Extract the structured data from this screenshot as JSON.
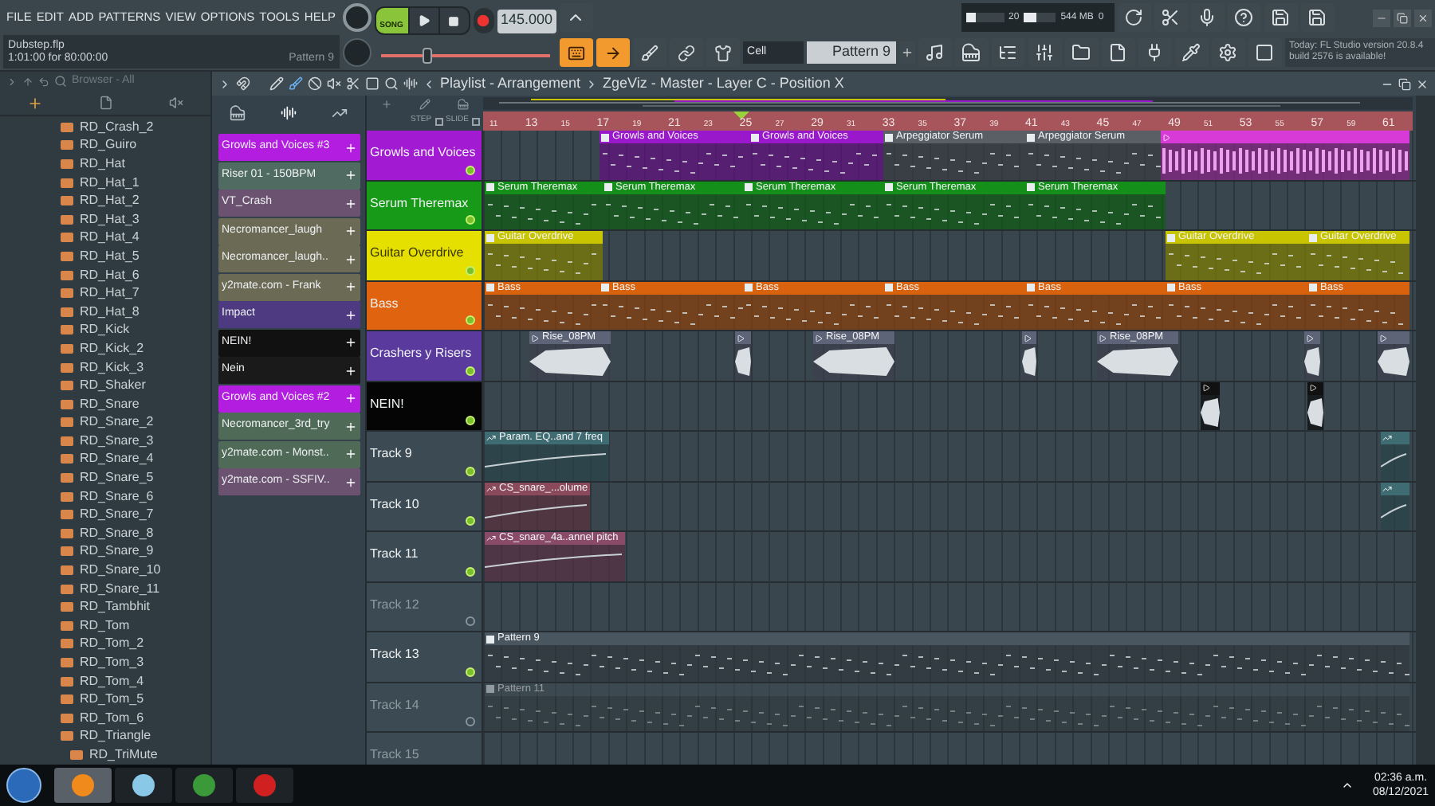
{
  "menu": [
    "FILE",
    "EDIT",
    "ADD",
    "PATTERNS",
    "VIEW",
    "OPTIONS",
    "TOOLS",
    "HELP"
  ],
  "hint_panel": {
    "file": "Dubstep.flp",
    "time": "1:01:00 for 80:00:00",
    "pattern": "Pattern 9"
  },
  "transport": {
    "mode": "SONG",
    "song_mode": true,
    "tempo": "145.000",
    "pitch": {
      "level": 0.28
    }
  },
  "toolbar_toggles": [
    {
      "kind": "keyboard",
      "selected": true
    },
    {
      "kind": "step",
      "selected": true
    },
    {
      "kind": "brush",
      "selected": false
    },
    {
      "kind": "link",
      "selected": false
    },
    {
      "kind": "hat",
      "selected": false
    }
  ],
  "snap": "Cell",
  "pattern_selector": "Pattern 9",
  "cpu": {
    "cpu": "20",
    "memory": "544 MB",
    "polyphony": "0",
    "cpu_meter": {
      "level": 0.25
    },
    "memory_meter": {
      "level": 0.4
    }
  },
  "news": "Today: FL Studio version 20.8.4 build 2576 is available!",
  "browser": {
    "title": "Browser - All",
    "items": [
      {
        "label": "RD_Crash_2"
      },
      {
        "label": "RD_Guiro"
      },
      {
        "label": "RD_Hat"
      },
      {
        "label": "RD_Hat_1"
      },
      {
        "label": "RD_Hat_2"
      },
      {
        "label": "RD_Hat_3"
      },
      {
        "label": "RD_Hat_4"
      },
      {
        "label": "RD_Hat_5"
      },
      {
        "label": "RD_Hat_6"
      },
      {
        "label": "RD_Hat_7"
      },
      {
        "label": "RD_Hat_8"
      },
      {
        "label": "RD_Kick"
      },
      {
        "label": "RD_Kick_2"
      },
      {
        "label": "RD_Kick_3"
      },
      {
        "label": "RD_Shaker"
      },
      {
        "label": "RD_Snare"
      },
      {
        "label": "RD_Snare_2"
      },
      {
        "label": "RD_Snare_3"
      },
      {
        "label": "RD_Snare_4"
      },
      {
        "label": "RD_Snare_5"
      },
      {
        "label": "RD_Snare_6"
      },
      {
        "label": "RD_Snare_7"
      },
      {
        "label": "RD_Snare_8"
      },
      {
        "label": "RD_Snare_9"
      },
      {
        "label": "RD_Snare_10"
      },
      {
        "label": "RD_Snare_11"
      },
      {
        "label": "RD_Tambhit"
      },
      {
        "label": "RD_Tom"
      },
      {
        "label": "RD_Tom_2"
      },
      {
        "label": "RD_Tom_3"
      },
      {
        "label": "RD_Tom_4"
      },
      {
        "label": "RD_Tom_5"
      },
      {
        "label": "RD_Tom_6"
      },
      {
        "label": "RD_Triangle",
        "children": [
          {
            "label": "RD_TriMute"
          }
        ]
      }
    ]
  },
  "playlist": {
    "title": "Playlist - Arrangement",
    "breadcrumb": "ZgeViz - Master - Layer C - Position X",
    "step_label": "STEP",
    "step_checked": false,
    "slide_label": "SLIDE",
    "slide_checked": false,
    "picker": [
      {
        "label": "Growls and Voices #3",
        "color": "#b21de0"
      },
      {
        "label": "Riser 01 - 150BPM",
        "color": "#4f6b62"
      },
      {
        "label": "VT_Crash",
        "color": "#6b5270"
      },
      {
        "label": "Necromancer_laugh",
        "color": "#6a6a55"
      },
      {
        "label": "Necromancer_laugh..",
        "color": "#6a6a55"
      },
      {
        "label": "y2mate.com - Frank",
        "color": "#6a6a55"
      },
      {
        "label": "Impact",
        "color": "#4e3a80"
      },
      {
        "label": "NEIN!",
        "color": "#111111"
      },
      {
        "label": "Nein",
        "color": "#1a1a1a"
      },
      {
        "label": "Growls and Voices #2",
        "color": "#b21de0"
      },
      {
        "label": "Necromancer_3rd_try",
        "color": "#4f6b58"
      },
      {
        "label": "y2mate.com - Monst..",
        "color": "#4f6b58"
      },
      {
        "label": "y2mate.com - SSFIV..",
        "color": "#6b5270"
      }
    ],
    "ruler": [
      "11",
      "13",
      "15",
      "17",
      "19",
      "21",
      "23",
      "25",
      "27",
      "29",
      "31",
      "33",
      "35",
      "37",
      "39",
      "41",
      "43",
      "45",
      "47",
      "49",
      "51",
      "53",
      "55",
      "57",
      "59",
      "61"
    ],
    "tracks": [
      {
        "name": "Growls and Voices",
        "color": "#a21ad2",
        "muted": false,
        "clips": [
          {
            "kind": "pattern",
            "label": "Growls and Voices",
            "color": "#9a18cc"
          },
          {
            "kind": "pattern",
            "label": "Growls and Voices",
            "color": "#9a18cc"
          },
          {
            "kind": "pattern",
            "label": "Arpeggiator Serum",
            "color": "#5a5f66"
          },
          {
            "kind": "pattern",
            "label": "Arpeggiator Serum",
            "color": "#5a5f66"
          },
          {
            "kind": "audio",
            "color": "#d83ad8"
          }
        ]
      },
      {
        "name": "Serum Theremax",
        "color": "#179a17",
        "muted": false,
        "clips": [
          {
            "kind": "pattern",
            "label": "Serum Theremax",
            "color": "#14901a"
          },
          {
            "kind": "pattern",
            "label": "Serum Theremax",
            "color": "#14901a"
          },
          {
            "kind": "pattern",
            "label": "Serum Theremax",
            "color": "#14901a"
          },
          {
            "kind": "pattern",
            "label": "Serum Theremax",
            "color": "#14901a"
          },
          {
            "kind": "pattern",
            "label": "Serum Theremax",
            "color": "#14901a"
          }
        ]
      },
      {
        "name": "Guitar Overdrive",
        "color": "#e6e000",
        "muted": false,
        "clips": [
          {
            "kind": "pattern",
            "label": "Guitar Overdrive",
            "color": "#c8c400"
          },
          {
            "kind": "pattern",
            "label": "Guitar Overdrive",
            "color": "#c8c400"
          },
          {
            "kind": "pattern",
            "label": "Guitar Overdrive",
            "color": "#c8c400"
          }
        ]
      },
      {
        "name": "Bass",
        "color": "#e0640f",
        "muted": false,
        "clips": [
          {
            "kind": "pattern",
            "label": "Bass",
            "color": "#d8620e"
          },
          {
            "kind": "pattern",
            "label": "Bass",
            "color": "#d8620e"
          },
          {
            "kind": "pattern",
            "label": "Bass",
            "color": "#d8620e"
          },
          {
            "kind": "pattern",
            "label": "Bass",
            "color": "#d8620e"
          },
          {
            "kind": "pattern",
            "label": "Bass",
            "color": "#d8620e"
          },
          {
            "kind": "pattern",
            "label": "Bass",
            "color": "#d8620e"
          },
          {
            "kind": "pattern",
            "label": "Bass",
            "color": "#d8620e"
          }
        ]
      },
      {
        "name": "Crashers y Risers",
        "color": "#5a3a9c",
        "muted": false,
        "clips": [
          {
            "kind": "audio",
            "label": "Rise_08PM",
            "color": "#5d6478"
          },
          {
            "kind": "audio",
            "color": "#5d6478"
          },
          {
            "kind": "audio",
            "label": "Rise_08PM",
            "color": "#5d6478"
          },
          {
            "kind": "audio",
            "color": "#5d6478"
          },
          {
            "kind": "audio",
            "label": "Rise_08PM",
            "color": "#5d6478"
          },
          {
            "kind": "audio",
            "color": "#5d6478"
          },
          {
            "kind": "audio",
            "color": "#5d6478"
          }
        ]
      },
      {
        "name": "NEIN!",
        "color": "#050505",
        "muted": false,
        "clips": [
          {
            "kind": "audio",
            "color": "#111111"
          },
          {
            "kind": "audio",
            "color": "#111111"
          }
        ]
      },
      {
        "name": "Track 9",
        "color": "#3c4a53",
        "muted": false,
        "clips": [
          {
            "kind": "automation",
            "label": "Param. EQ..and 7 freq",
            "color": "#3f6b72"
          },
          {
            "kind": "automation",
            "color": "#3f6b72"
          }
        ]
      },
      {
        "name": "Track 10",
        "color": "#3c4a53",
        "muted": false,
        "clips": [
          {
            "kind": "automation",
            "label": "CS_snare_...olume",
            "color": "#8a4a5c"
          },
          {
            "kind": "automation",
            "color": "#3f6b72"
          }
        ]
      },
      {
        "name": "Track 11",
        "color": "#3c4a53",
        "muted": false,
        "clips": [
          {
            "kind": "automation",
            "label": "CS_snare_4a..annel pitch",
            "color": "#8a4a6a"
          }
        ]
      },
      {
        "name": "Track 12",
        "color": "#3c4a53",
        "muted": true
      },
      {
        "name": "Track 13",
        "color": "#3c4a53",
        "muted": false,
        "clips": [
          {
            "kind": "pattern",
            "label": "Pattern 9",
            "color": "#4a565f"
          }
        ]
      },
      {
        "name": "Track 14",
        "color": "#3c4a53",
        "muted": true,
        "clips": [
          {
            "kind": "pattern",
            "label": "Pattern 11",
            "color": "#414c54"
          }
        ]
      },
      {
        "name": "Track 15",
        "color": "#3c4a53",
        "muted": true
      }
    ]
  },
  "taskbar": {
    "apps": [
      {
        "kind": "fl",
        "selected": true
      },
      {
        "kind": "files",
        "selected": false
      },
      {
        "kind": "chrome",
        "selected": false
      },
      {
        "kind": "recorder",
        "selected": false
      }
    ],
    "time": "02:36 a.m.",
    "date": "08/12/2021"
  }
}
